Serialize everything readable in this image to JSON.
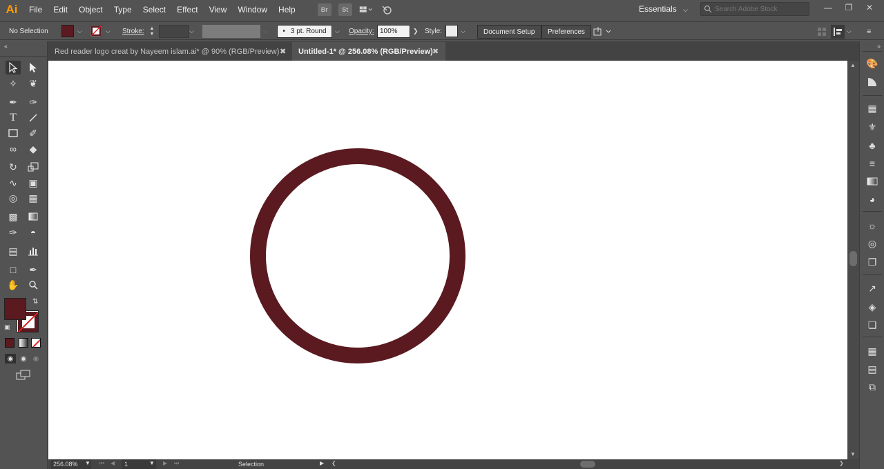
{
  "app": {
    "logo": "Ai",
    "menu": [
      "File",
      "Edit",
      "Object",
      "Type",
      "Select",
      "Effect",
      "View",
      "Window",
      "Help"
    ],
    "bridge_label": "Br",
    "stock_label": "St",
    "workspace": "Essentials",
    "search_placeholder": "Search Adobe Stock"
  },
  "control": {
    "selection_status": "No Selection",
    "fill_color": "#5a1a20",
    "stroke_label": "Stroke:",
    "profile": "3 pt. Round",
    "profile_dot": "•",
    "opacity_label": "Opacity:",
    "opacity_value": "100%",
    "style_label": "Style:",
    "document_setup": "Document Setup",
    "preferences": "Preferences"
  },
  "tabs": [
    {
      "label": "Red reader logo creat by Nayeem islam.ai* @ 90% (RGB/Preview)",
      "active": false
    },
    {
      "label": "Untitled-1* @ 256.08% (RGB/Preview)",
      "active": true
    }
  ],
  "artwork": {
    "shape": "ring",
    "stroke_color": "#5a1a20",
    "fill": "none"
  },
  "status": {
    "zoom": "256.08%",
    "artboard": "1",
    "tool": "Selection"
  }
}
